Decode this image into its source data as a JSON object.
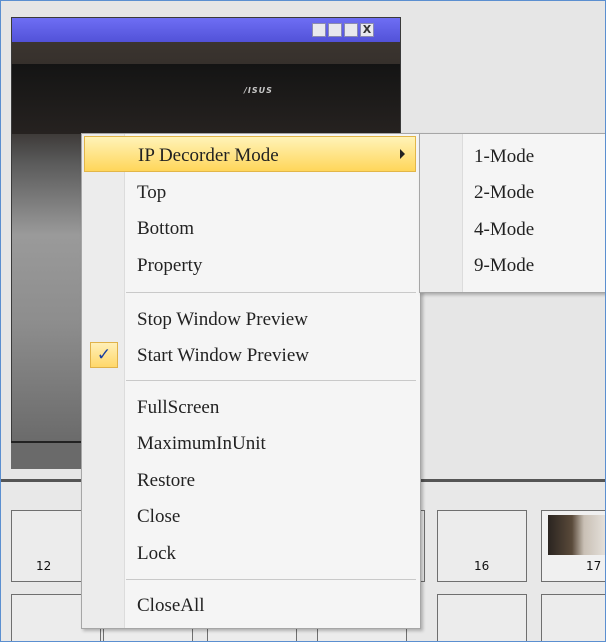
{
  "video_window": {
    "titlebar_buttons": [
      "restore-icon",
      "popout-icon",
      "maximize-icon",
      "close-icon"
    ],
    "close_glyph": "X",
    "brand_text": "/ISUS",
    "titlebar_color": "#5a5ae6"
  },
  "thumbnails": {
    "row1": [
      {
        "label": "12"
      },
      {
        "label": ""
      },
      {
        "label": ""
      },
      {
        "label": ""
      },
      {
        "label": "16"
      },
      {
        "label": "17"
      }
    ]
  },
  "context_menu": {
    "items": [
      {
        "label": "IP Decorder Mode",
        "has_submenu": true,
        "highlighted": true
      },
      {
        "label": "Top"
      },
      {
        "label": "Bottom"
      },
      {
        "label": "Property"
      },
      {
        "label": "Stop Window Preview"
      },
      {
        "label": "Start Window Preview",
        "checked": true
      },
      {
        "label": "FullScreen"
      },
      {
        "label": "MaximumInUnit"
      },
      {
        "label": "Restore"
      },
      {
        "label": "Close"
      },
      {
        "label": "Lock"
      },
      {
        "label": "CloseAll"
      }
    ],
    "check_glyph": "✓",
    "highlight_color": "#ffd65a"
  },
  "submenu": {
    "items": [
      {
        "label": "1-Mode"
      },
      {
        "label": "2-Mode"
      },
      {
        "label": "4-Mode"
      },
      {
        "label": "9-Mode"
      }
    ]
  }
}
